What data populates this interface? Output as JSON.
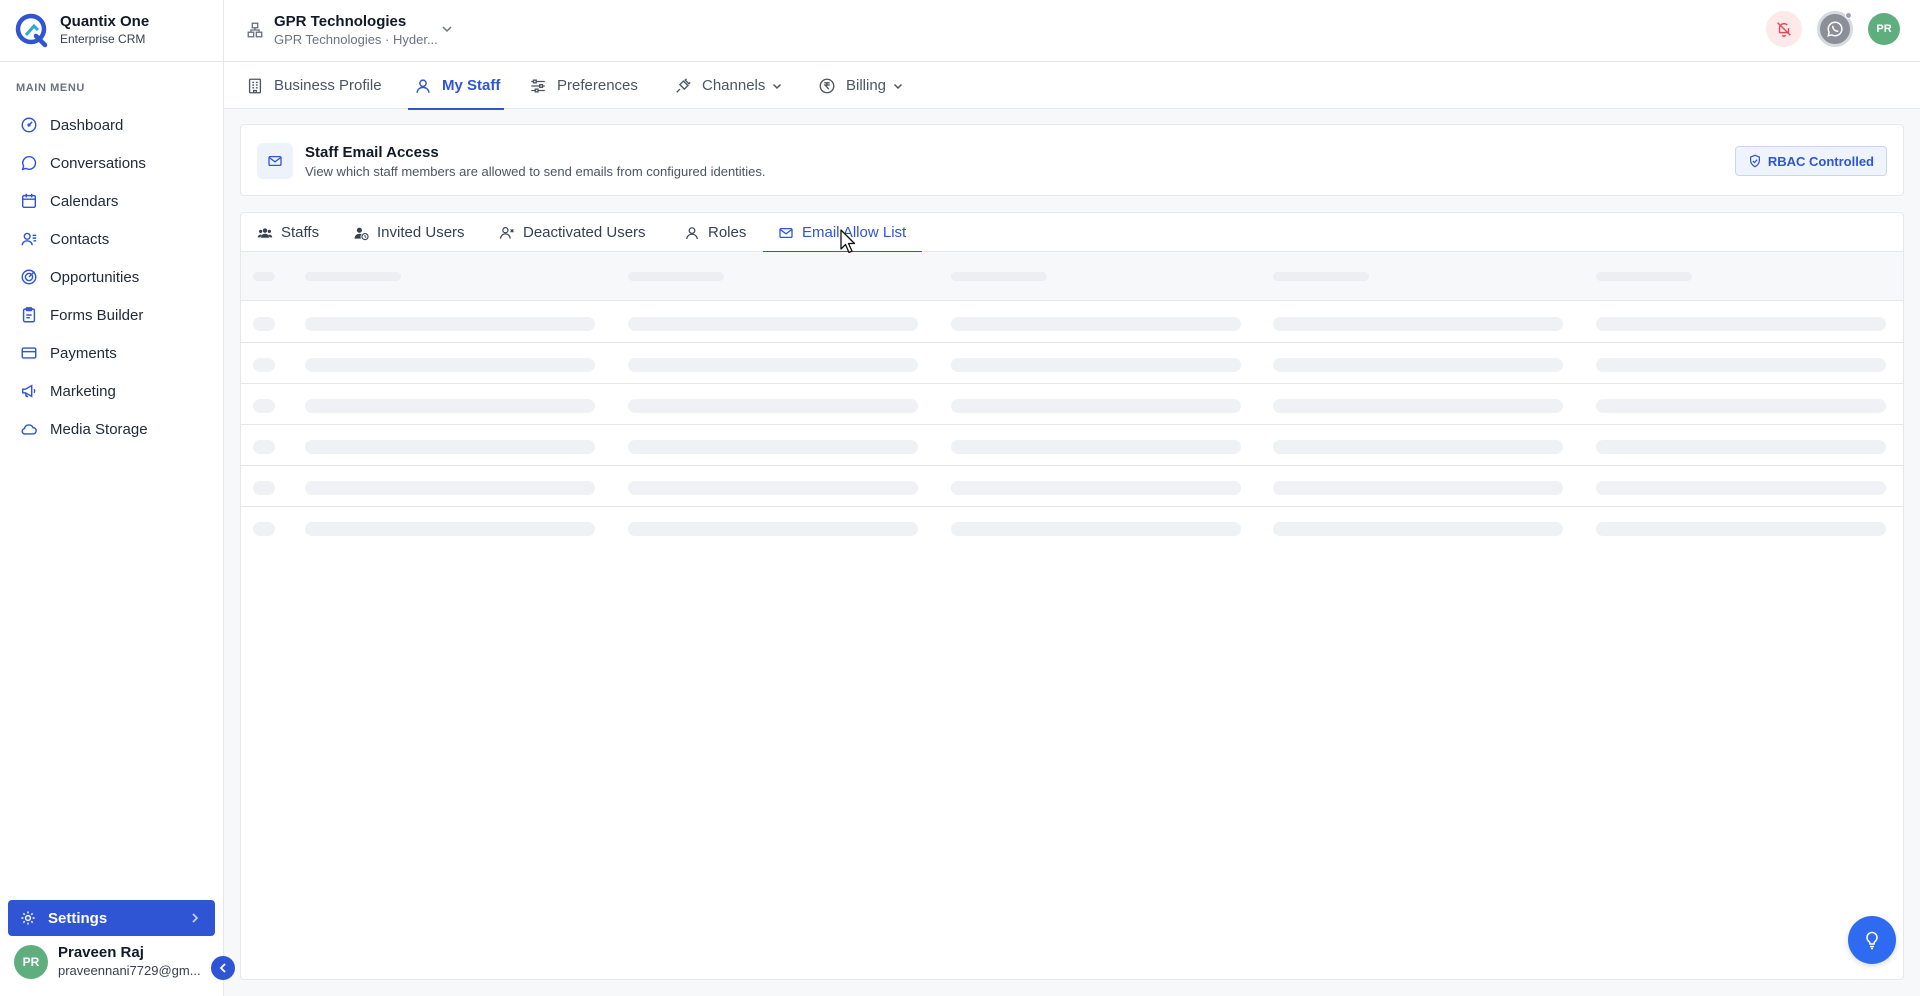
{
  "brand": {
    "name": "Quantix One",
    "subtitle": "Enterprise CRM"
  },
  "sidebar": {
    "heading": "MAIN MENU",
    "items": [
      {
        "label": "Dashboard",
        "icon": "dashboard-icon"
      },
      {
        "label": "Conversations",
        "icon": "chat-icon"
      },
      {
        "label": "Calendars",
        "icon": "calendar-icon"
      },
      {
        "label": "Contacts",
        "icon": "contacts-icon"
      },
      {
        "label": "Opportunities",
        "icon": "target-icon"
      },
      {
        "label": "Forms Builder",
        "icon": "clipboard-icon"
      },
      {
        "label": "Payments",
        "icon": "credit-card-icon"
      },
      {
        "label": "Marketing",
        "icon": "megaphone-icon"
      },
      {
        "label": "Media Storage",
        "icon": "cloud-icon"
      }
    ],
    "settings_label": "Settings",
    "user": {
      "initials": "PR",
      "name": "Praveen Raj",
      "email": "praveennani7729@gm..."
    }
  },
  "topbar": {
    "org_name": "GPR Technologies",
    "org_sub": "GPR Technologies · Hyder...",
    "avatar_initials": "PR"
  },
  "subnav": {
    "items": [
      {
        "label": "Business Profile"
      },
      {
        "label": "My Staff"
      },
      {
        "label": "Preferences"
      },
      {
        "label": "Channels"
      },
      {
        "label": "Billing"
      }
    ],
    "active": "My Staff"
  },
  "panel": {
    "title": "Staff Email Access",
    "description": "View which staff members are allowed to send emails from configured identities.",
    "badge": "RBAC Controlled"
  },
  "tabs": {
    "items": [
      {
        "label": "Staffs"
      },
      {
        "label": "Invited Users"
      },
      {
        "label": "Deactivated Users"
      },
      {
        "label": "Roles"
      },
      {
        "label": "Email Allow List"
      }
    ],
    "active": "Email Allow List"
  },
  "table": {
    "state": "loading",
    "skeleton_rows": 6,
    "skeleton_columns": 5
  },
  "colors": {
    "accent": "#2f55d4",
    "sidebar_bg": "#ffffff",
    "page_bg": "#f7f8fa",
    "avatar": "#5fae7e",
    "fab": "#2f6bf0"
  }
}
